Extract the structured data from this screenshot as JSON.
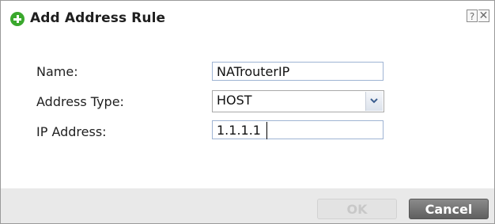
{
  "dialog": {
    "title": "Add Address Rule",
    "help_label": "?",
    "close_label": "✕"
  },
  "form": {
    "name_label": "Name:",
    "name_value": "NATrouterIP",
    "address_type_label": "Address Type:",
    "address_type_value": "HOST",
    "ip_label": "IP Address:",
    "ip_value": "1.1.1.1"
  },
  "buttons": {
    "ok_label": "OK",
    "cancel_label": "Cancel"
  },
  "colors": {
    "add_icon": "#3aa82d",
    "footer_bg": "#e9e9e9",
    "cancel_bg": "#6f6f6f"
  }
}
